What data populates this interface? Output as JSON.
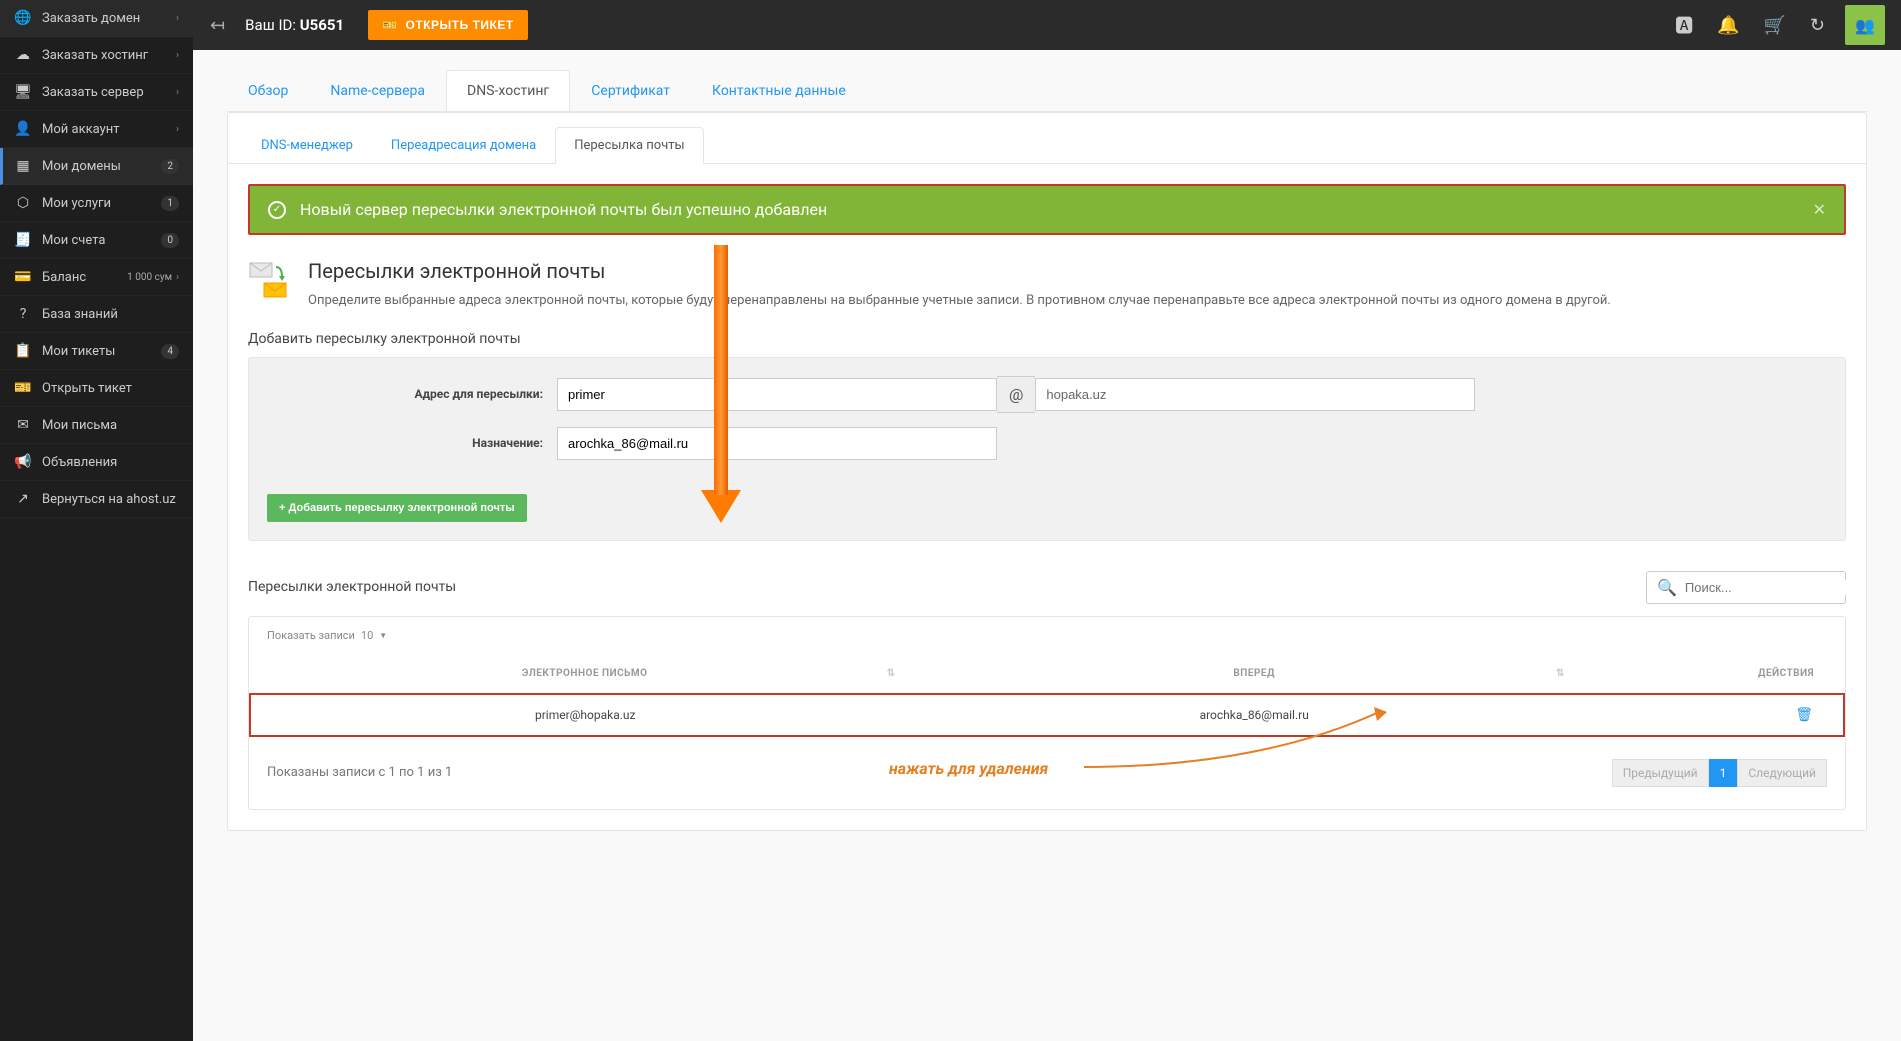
{
  "topbar": {
    "user_id_label": "Ваш ID:",
    "user_id_value": "U5651",
    "ticket_btn": "ОТКРЫТЬ ТИКЕТ"
  },
  "sidebar": {
    "items": [
      {
        "icon": "🌐",
        "label": "Заказать домен",
        "chev": true
      },
      {
        "icon": "☁",
        "label": "Заказать хостинг",
        "chev": true
      },
      {
        "icon": "🖥",
        "label": "Заказать сервер",
        "chev": true
      },
      {
        "icon": "👤",
        "label": "Мой аккаунт",
        "chev": true
      },
      {
        "icon": "▦",
        "label": "Мои домены",
        "badge": "2",
        "active": true
      },
      {
        "icon": "⬡",
        "label": "Мои услуги",
        "badge": "1"
      },
      {
        "icon": "🧾",
        "label": "Мои счета",
        "badge": "0"
      },
      {
        "icon": "💳",
        "label": "Баланс",
        "balance": "1 000 сум",
        "chev": true
      },
      {
        "icon": "?",
        "label": "База знаний"
      },
      {
        "icon": "📋",
        "label": "Мои тикеты",
        "badge": "4"
      },
      {
        "icon": "🎫",
        "label": "Открыть тикет"
      },
      {
        "icon": "✉",
        "label": "Мои письма"
      },
      {
        "icon": "📢",
        "label": "Объявления"
      },
      {
        "icon": "↗",
        "label": "Вернуться на ahost.uz"
      }
    ]
  },
  "tabs_primary": [
    {
      "label": "Обзор"
    },
    {
      "label": "Name-сервера"
    },
    {
      "label": "DNS-хостинг",
      "active": true
    },
    {
      "label": "Сертификат"
    },
    {
      "label": "Контактные данные"
    }
  ],
  "tabs_secondary": [
    {
      "label": "DNS-менеджер"
    },
    {
      "label": "Переадресация домена"
    },
    {
      "label": "Пересылка почты",
      "active": true
    }
  ],
  "alert": {
    "message": "Новый сервер пересылки электронной почты был успешно добавлен"
  },
  "section": {
    "title": "Пересылки электронной почты",
    "desc": "Определите выбранные адреса электронной почты, которые будут перенаправлены на выбранные учетные записи. В противном случае перенаправьте все адреса электронной почты из одного домена в другой."
  },
  "form": {
    "heading": "Добавить пересылку электронной почты",
    "address_label": "Адрес для пересылки:",
    "address_value": "primer",
    "at_symbol": "@",
    "domain_value": "hopaka.uz",
    "dest_label": "Назначение:",
    "dest_value": "arochka_86@mail.ru",
    "add_btn": "Добавить пересылку электронной почты"
  },
  "list": {
    "title": "Пересылки электронной почты",
    "search_placeholder": "Поиск...",
    "show_label": "Показать записи",
    "show_count": "10",
    "columns": {
      "email": "ЭЛЕКТРОННОЕ ПИСЬМО",
      "forward": "ВПЕРЕД",
      "actions": "ДЕЙСТВИЯ"
    },
    "rows": [
      {
        "email": "primer@hopaka.uz",
        "forward": "arochka_86@mail.ru"
      }
    ],
    "footer_info": "Показаны записи с 1 по 1 из 1",
    "pag_prev": "Предыдущий",
    "pag_current": "1",
    "pag_next": "Следующий"
  },
  "annotation": {
    "delete_hint": "нажать для удаления"
  }
}
